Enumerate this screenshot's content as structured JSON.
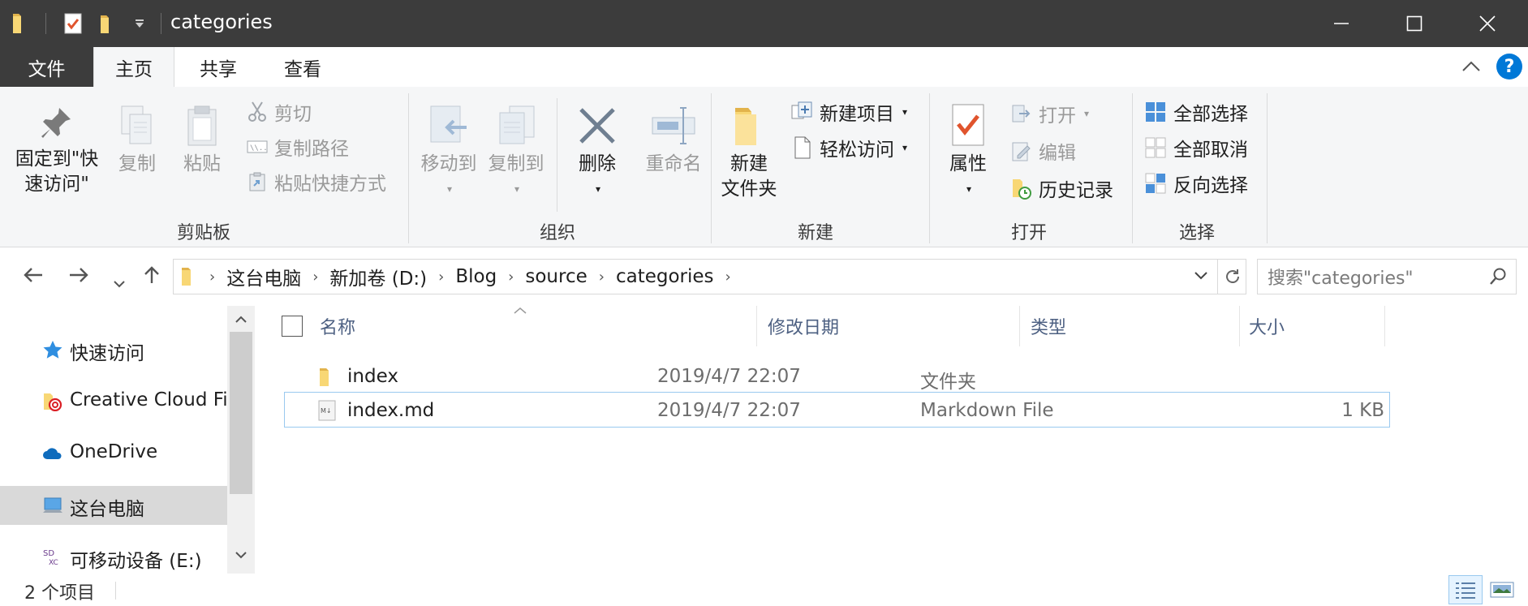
{
  "window": {
    "title": "categories",
    "colors": {
      "titlebar": "#3c3c3c",
      "accent": "#0078d7",
      "folder": "#f8d775"
    }
  },
  "tabs": [
    {
      "label": "文件"
    },
    {
      "label": "主页"
    },
    {
      "label": "共享"
    },
    {
      "label": "查看"
    }
  ],
  "ribbon": {
    "clipboard": {
      "pin_line1": "固定到\"快",
      "pin_line2": "速访问\"",
      "copy": "复制",
      "paste": "粘贴",
      "cut": "剪切",
      "copy_path": "复制路径",
      "paste_shortcut": "粘贴快捷方式",
      "group": "剪贴板"
    },
    "organize": {
      "move_to": "移动到",
      "copy_to": "复制到",
      "delete": "删除",
      "rename": "重命名",
      "group": "组织"
    },
    "new": {
      "new_folder_line1": "新建",
      "new_folder_line2": "文件夹",
      "new_item": "新建项目",
      "easy_access": "轻松访问",
      "group": "新建"
    },
    "open": {
      "properties": "属性",
      "open": "打开",
      "edit": "编辑",
      "history": "历史记录",
      "group": "打开"
    },
    "select": {
      "select_all": "全部选择",
      "select_none": "全部取消",
      "invert": "反向选择",
      "group": "选择"
    }
  },
  "address": {
    "crumbs": [
      "这台电脑",
      "新加卷 (D:)",
      "Blog",
      "source",
      "categories"
    ],
    "search_placeholder": "搜索\"categories\""
  },
  "navpane": {
    "items": [
      {
        "label": "快速访问",
        "icon": "star-icon"
      },
      {
        "label": "Creative Cloud Files",
        "icon": "creative-cloud-icon"
      },
      {
        "label": "OneDrive",
        "icon": "cloud-icon"
      },
      {
        "label": "这台电脑",
        "icon": "computer-icon",
        "selected": true
      },
      {
        "label": "可移动设备 (E:)",
        "icon": "sd-card-icon"
      }
    ]
  },
  "columns": {
    "name": "名称",
    "modified": "修改日期",
    "type": "类型",
    "size": "大小"
  },
  "files": [
    {
      "name": "index",
      "modified": "2019/4/7 22:07",
      "type": "文件夹",
      "size": "",
      "icon": "folder-icon"
    },
    {
      "name": "index.md",
      "modified": "2019/4/7 22:07",
      "type": "Markdown File",
      "size": "1 KB",
      "icon": "markdown-file-icon"
    }
  ],
  "status": {
    "item_count": "2 个项目"
  }
}
